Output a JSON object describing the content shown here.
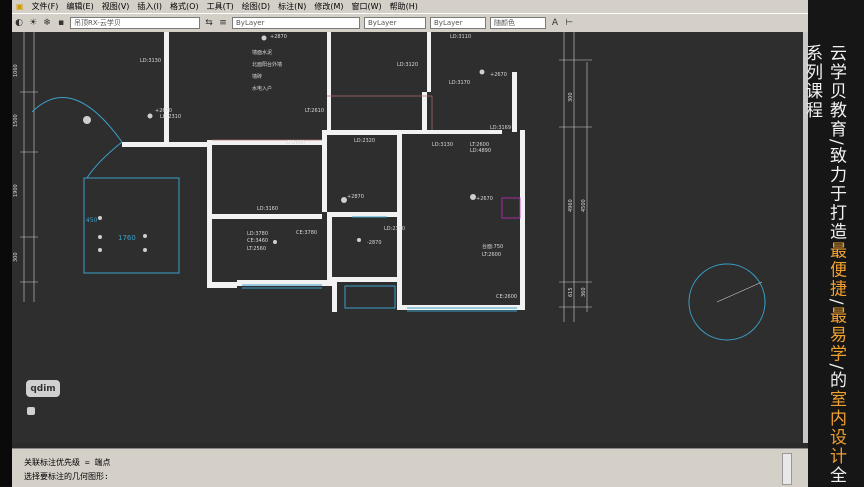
{
  "menu": [
    "文件(F)",
    "编辑(E)",
    "视图(V)",
    "插入(I)",
    "格式(O)",
    "工具(T)",
    "绘图(D)",
    "标注(N)",
    "修改(M)",
    "窗口(W)",
    "帮助(H)"
  ],
  "toolbar": {
    "layer_combo": "吊顶RX-云学贝",
    "linetype_combo": "ByLayer",
    "lineweight_combo": "ByLayer",
    "plotstyle_combo": "ByLayer",
    "color_combo": "随颜色"
  },
  "drawing": {
    "dimension_left": [
      "1060",
      "1500",
      "1900",
      "300"
    ],
    "dimension_right": [
      "300",
      "4960",
      "4500",
      "615",
      "360"
    ],
    "dim_1760": "1760",
    "dim_450": "450",
    "note": [
      "墙面水泥",
      "北面阳台外墙",
      "墙砖",
      "水电入户"
    ],
    "room_labels": [
      "LD:3130",
      "LD:3120",
      "LD:2310",
      "LD:3110",
      "LT:2610",
      "LD:3170",
      "LD:3169",
      "LD:3130",
      "LD:2320",
      "CE:3460",
      "LT:2560",
      "LD:3780",
      "CE:3780",
      "LD:3160",
      "LD:2350",
      "LT:2600",
      "LD:4890",
      "LT:2600",
      "台面:750",
      "LT:2600",
      "CE:2600"
    ],
    "tag_labels": [
      "+2870",
      "+2670",
      "-2870",
      "+2670",
      "+2870",
      "+2670"
    ],
    "color_bylayer": "ByLayer"
  },
  "command": {
    "line1": "关联标注优先级 = 端点",
    "line2": "选择要标注的几何图形:"
  },
  "watermark": "qdim",
  "banner": {
    "part1": "云学贝教育/致力于打造",
    "hl1": "最便捷",
    "sep1": "/",
    "hl2": "最易学",
    "part2": "/的",
    "hl3": "室内设计",
    "part3": "全系列课程"
  }
}
